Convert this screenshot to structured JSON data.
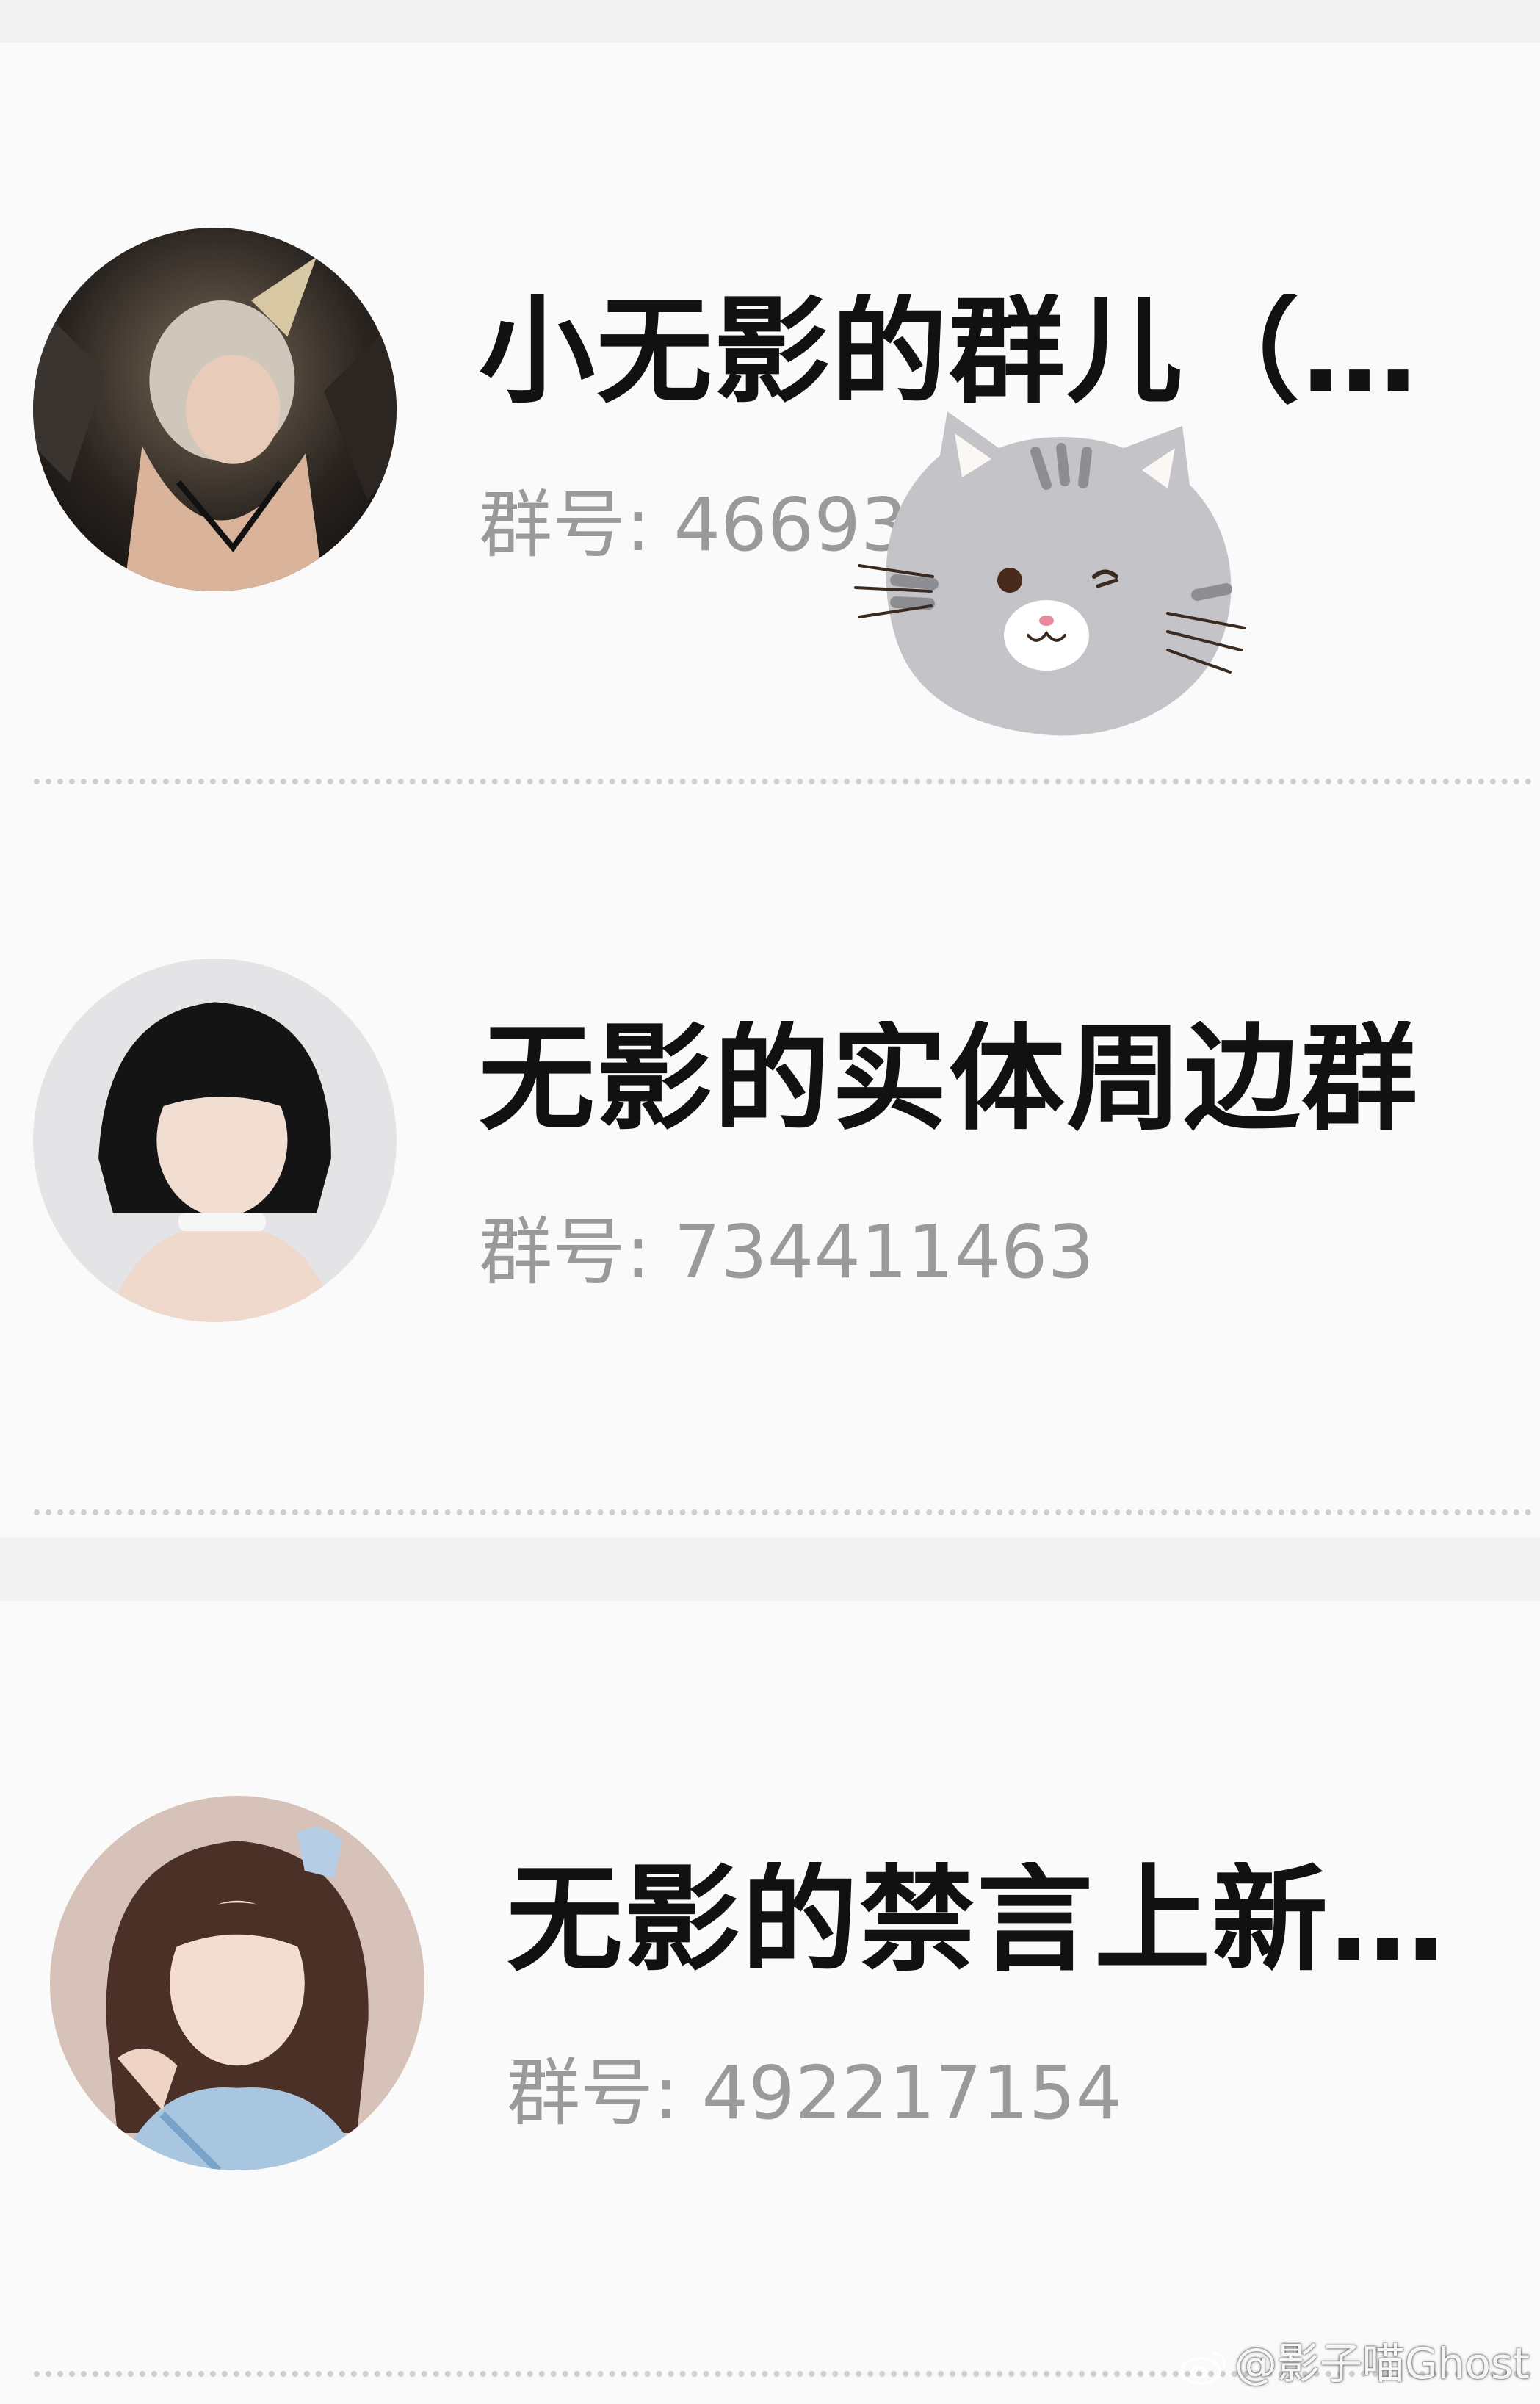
{
  "groups": [
    {
      "name": "小无影的群儿（一…",
      "id_label": "群号:",
      "id_value": "46693"
    },
    {
      "name": "无影的实体周边群",
      "id_label": "群号:",
      "id_value": "734411463"
    },
    {
      "name": "无影的禁言上新通…",
      "id_label": "群号:",
      "id_value": "492217154"
    }
  ],
  "sticker": {
    "icon": "winking-cat-icon"
  },
  "watermark": {
    "icon": "weibo-icon",
    "text": "@影子喵Ghost"
  },
  "colors": {
    "background": "#f2f2f2",
    "card": "#fafafa",
    "title": "#111111",
    "subtitle": "#9a9a9a",
    "divider": "#cfcfcf"
  }
}
